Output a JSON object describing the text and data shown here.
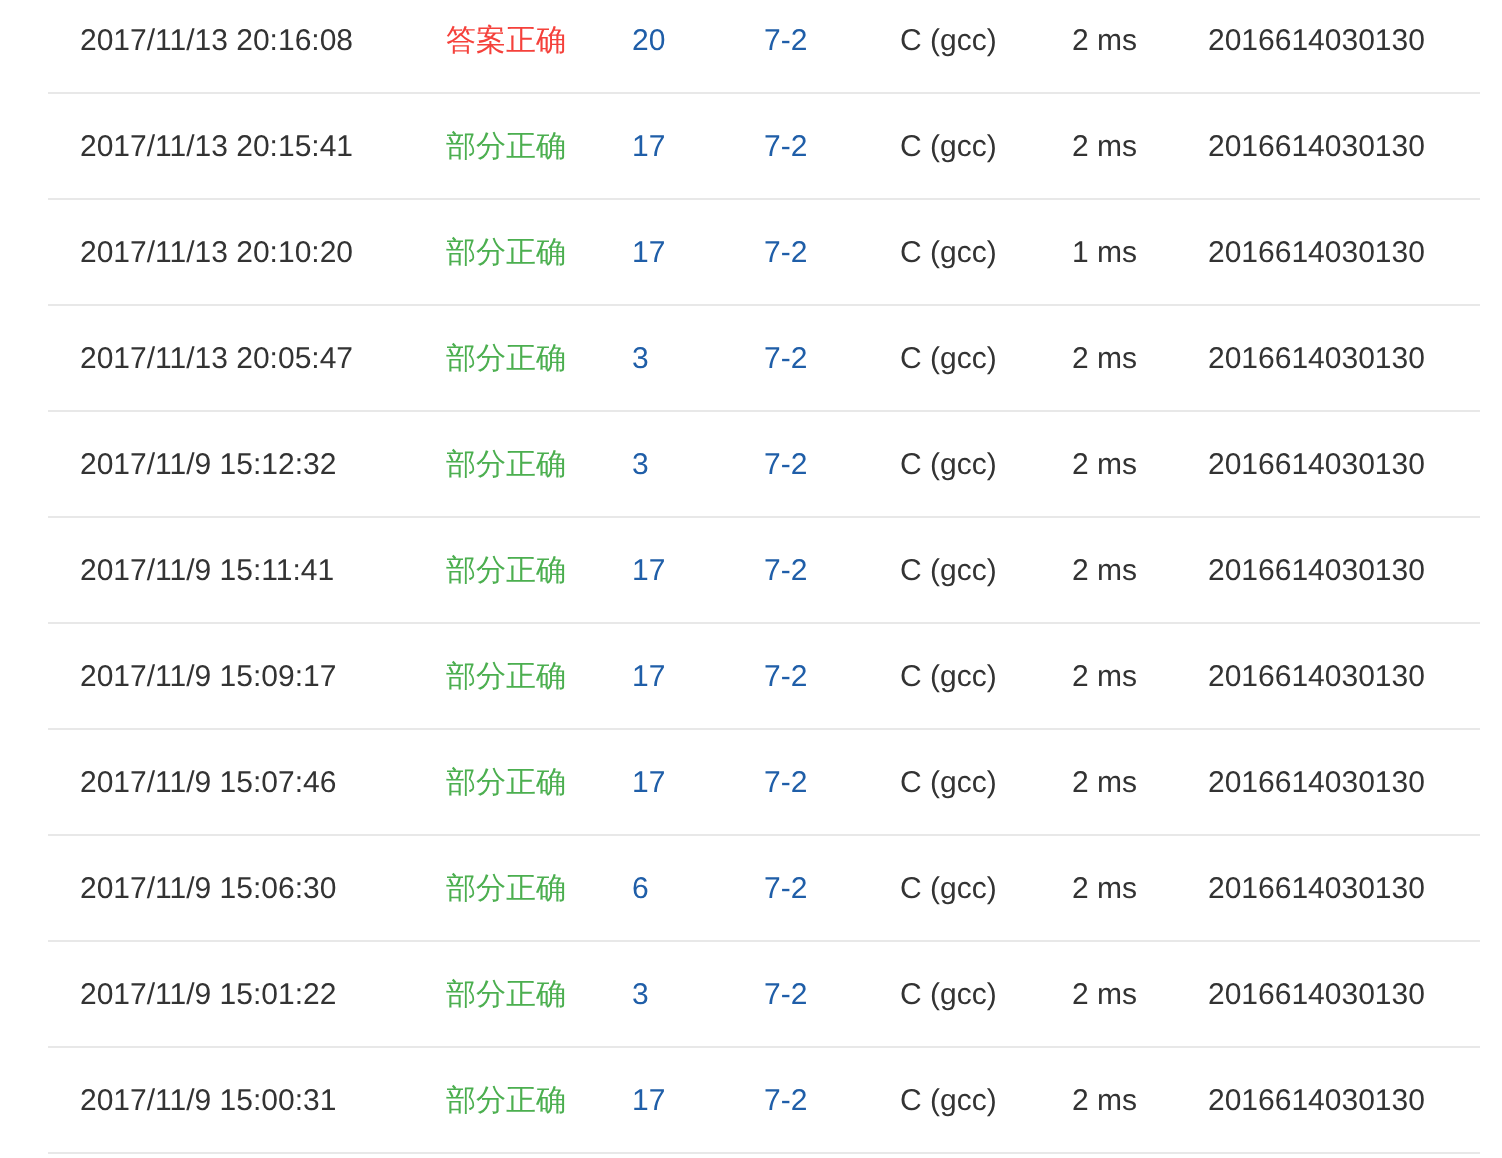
{
  "submissions": [
    {
      "time": "2017/11/13 20:16:08",
      "status": {
        "kind": "accepted",
        "label": "答案正确"
      },
      "score": "20",
      "problem": "7-2",
      "compiler": "C (gcc)",
      "duration": "2 ms",
      "user": "2016614030130"
    },
    {
      "time": "2017/11/13 20:15:41",
      "status": {
        "kind": "partial",
        "label": "部分正确"
      },
      "score": "17",
      "problem": "7-2",
      "compiler": "C (gcc)",
      "duration": "2 ms",
      "user": "2016614030130"
    },
    {
      "time": "2017/11/13 20:10:20",
      "status": {
        "kind": "partial",
        "label": "部分正确"
      },
      "score": "17",
      "problem": "7-2",
      "compiler": "C (gcc)",
      "duration": "1 ms",
      "user": "2016614030130"
    },
    {
      "time": "2017/11/13 20:05:47",
      "status": {
        "kind": "partial",
        "label": "部分正确"
      },
      "score": "3",
      "problem": "7-2",
      "compiler": "C (gcc)",
      "duration": "2 ms",
      "user": "2016614030130"
    },
    {
      "time": "2017/11/9 15:12:32",
      "status": {
        "kind": "partial",
        "label": "部分正确"
      },
      "score": "3",
      "problem": "7-2",
      "compiler": "C (gcc)",
      "duration": "2 ms",
      "user": "2016614030130"
    },
    {
      "time": "2017/11/9 15:11:41",
      "status": {
        "kind": "partial",
        "label": "部分正确"
      },
      "score": "17",
      "problem": "7-2",
      "compiler": "C (gcc)",
      "duration": "2 ms",
      "user": "2016614030130"
    },
    {
      "time": "2017/11/9 15:09:17",
      "status": {
        "kind": "partial",
        "label": "部分正确"
      },
      "score": "17",
      "problem": "7-2",
      "compiler": "C (gcc)",
      "duration": "2 ms",
      "user": "2016614030130"
    },
    {
      "time": "2017/11/9 15:07:46",
      "status": {
        "kind": "partial",
        "label": "部分正确"
      },
      "score": "17",
      "problem": "7-2",
      "compiler": "C (gcc)",
      "duration": "2 ms",
      "user": "2016614030130"
    },
    {
      "time": "2017/11/9 15:06:30",
      "status": {
        "kind": "partial",
        "label": "部分正确"
      },
      "score": "6",
      "problem": "7-2",
      "compiler": "C (gcc)",
      "duration": "2 ms",
      "user": "2016614030130"
    },
    {
      "time": "2017/11/9 15:01:22",
      "status": {
        "kind": "partial",
        "label": "部分正确"
      },
      "score": "3",
      "problem": "7-2",
      "compiler": "C (gcc)",
      "duration": "2 ms",
      "user": "2016614030130"
    },
    {
      "time": "2017/11/9 15:00:31",
      "status": {
        "kind": "partial",
        "label": "部分正确"
      },
      "score": "17",
      "problem": "7-2",
      "compiler": "C (gcc)",
      "duration": "2 ms",
      "user": "2016614030130"
    }
  ]
}
